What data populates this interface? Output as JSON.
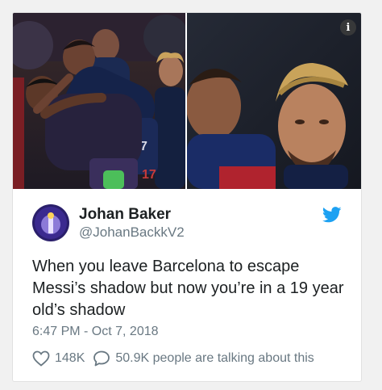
{
  "tweet": {
    "author_name": "Johan Baker",
    "author_handle": "@JohanBackkV2",
    "text": "When you leave Barcelona to escape Messi’s shadow but now you’re in a 19 year old’s shadow",
    "timestamp": "6:47 PM - Oct 7, 2018",
    "likes": "148K",
    "conversation": "50.9K people are talking about this"
  },
  "icons": {
    "info": "info-icon",
    "twitter": "twitter-bird-icon",
    "like": "heart-icon",
    "reply": "speech-bubble-icon"
  },
  "colors": {
    "twitter_blue": "#1da1f2",
    "text": "#1c2022",
    "muted": "#697882"
  }
}
